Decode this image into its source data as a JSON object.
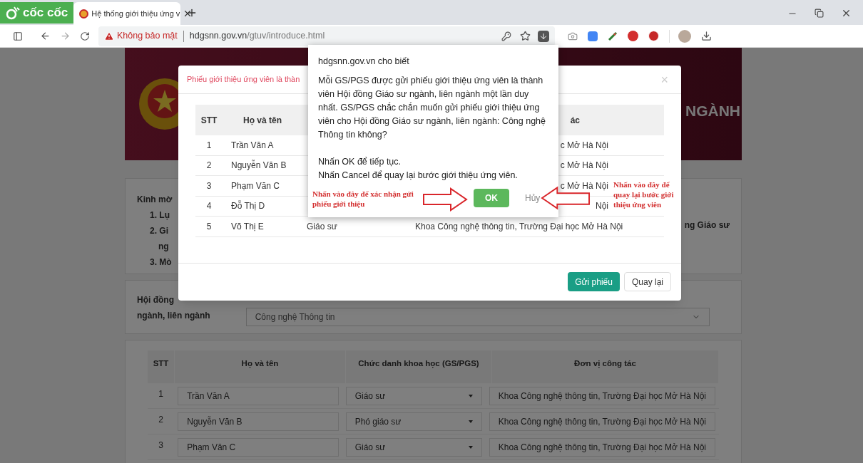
{
  "browser": {
    "logo": "cốc cốc",
    "tab": {
      "title": "Hệ thống giới thiệu ứng v",
      "selected": true
    },
    "address": {
      "warning": "Không bảo mật",
      "host": "hdgsnn.gov.vn",
      "path": "/gtuv/introduce.html"
    }
  },
  "page": {
    "banner_text": "NGÀNH",
    "intro": {
      "lead": "Kinh mờ",
      "items": [
        "1. Lụ",
        "2. Gi",
        "ng",
        "3. Mò"
      ],
      "right_fragment": "ng Giáo sư"
    },
    "council": {
      "label_lines": [
        "Hội đồng",
        "ngành, liên ngành"
      ],
      "value": "Công nghệ Thông tin"
    },
    "table": {
      "columns": [
        "STT",
        "Họ và tên",
        "Chức danh khoa học (GS/PGS)",
        "Đơn vị công tác"
      ],
      "rows": [
        {
          "stt": "1",
          "name": "Trần Văn A",
          "title": "Giáo sư",
          "unit": "Khoa Công nghệ thông tin, Trường Đại học Mở Hà Nội"
        },
        {
          "stt": "2",
          "name": "Nguyễn Văn B",
          "title": "Phó giáo sư",
          "unit": "Khoa Công nghệ thông tin, Trường Đại học Mở Hà Nội"
        },
        {
          "stt": "3",
          "name": "Phạm Văn C",
          "title": "Giáo sư",
          "unit": "Khoa Công nghệ thông tin, Trường Đại học Mở Hà Nội"
        }
      ]
    }
  },
  "modal": {
    "title": "Phiếu giới thiệu ứng viên là thàn",
    "close": "×",
    "table": {
      "header": {
        "stt": "STT",
        "name": "Họ và tên",
        "unit": "ác"
      },
      "rows": [
        {
          "stt": "1",
          "name": "Trần Văn A",
          "unit": "c Mở Hà Nội"
        },
        {
          "stt": "2",
          "name": "Nguyễn Văn B",
          "unit": "c Mở Hà Nội"
        },
        {
          "stt": "3",
          "name": "Phạm Văn C",
          "unit": "c Mở Hà Nội"
        },
        {
          "stt": "4",
          "name": "Đỗ Thị D",
          "unit": "Nội"
        },
        {
          "stt": "5",
          "name": "Võ Thị E",
          "title": "Giáo sư",
          "unit": "Khoa Công nghệ thông tin, Trường Đại học Mở Hà Nội"
        }
      ]
    },
    "buttons": [
      {
        "label": "Gửi phiếu",
        "kind": "primary"
      },
      {
        "label": "Quay lại",
        "kind": "default"
      }
    ]
  },
  "alert": {
    "origin": "hdgsnn.gov.vn cho biết",
    "message": "Mỗi GS/PGS được gửi phiếu giới thiệu ứng viên là thành viên Hội đồng Giáo sư ngành, liên ngành một lần duy nhất. GS/PGS chắc chắn muốn gửi phiếu giới thiệu ứng viên cho Hội đồng Giáo sư ngành, liên ngành: Công nghệ Thông tin không?",
    "lines": [
      "Nhấn OK để tiếp tục.",
      "Nhấn Cancel để quay lại bước giới thiệu ứng viên."
    ],
    "ok": "OK",
    "cancel": "Hủy"
  },
  "annotations": [
    {
      "text": "Nhấn vào đây để xác nhận gửi phiếu giới thiệu",
      "kind": "confirm"
    },
    {
      "text": "Nhấn vào đây để quay lại bước giới thiệu ứng viên",
      "kind": "back"
    }
  ]
}
